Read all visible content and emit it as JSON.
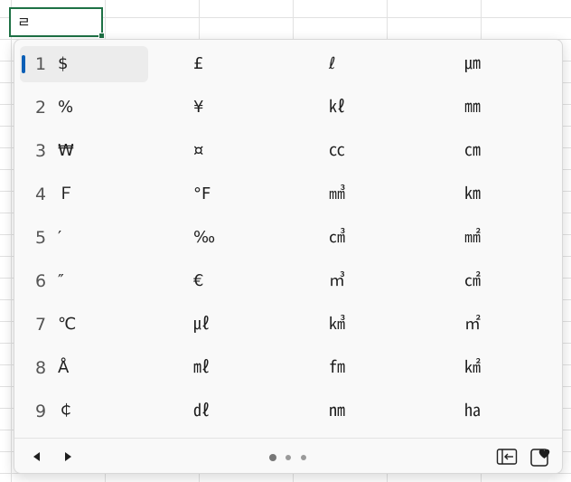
{
  "cell": {
    "value": "ㄹ"
  },
  "candidates": {
    "columns": [
      [
        {
          "num": "1",
          "sym": "$",
          "selected": true
        },
        {
          "num": "2",
          "sym": "%"
        },
        {
          "num": "3",
          "sym": "₩"
        },
        {
          "num": "4",
          "sym": "Ｆ"
        },
        {
          "num": "5",
          "sym": "′"
        },
        {
          "num": "6",
          "sym": "″"
        },
        {
          "num": "7",
          "sym": "℃"
        },
        {
          "num": "8",
          "sym": "Å"
        },
        {
          "num": "9",
          "sym": "￠"
        }
      ],
      [
        {
          "sym": "£"
        },
        {
          "sym": "¥"
        },
        {
          "sym": "¤"
        },
        {
          "sym": "°F"
        },
        {
          "sym": "‰"
        },
        {
          "sym": "€"
        },
        {
          "sym": "㎕"
        },
        {
          "sym": "㎖"
        },
        {
          "sym": "㎗"
        }
      ],
      [
        {
          "sym": "ℓ"
        },
        {
          "sym": "㎘"
        },
        {
          "sym": "㏄"
        },
        {
          "sym": "㎣"
        },
        {
          "sym": "㎤"
        },
        {
          "sym": "㎥"
        },
        {
          "sym": "㎦"
        },
        {
          "sym": "㎙"
        },
        {
          "sym": "㎚"
        }
      ],
      [
        {
          "sym": "㎛"
        },
        {
          "sym": "㎜"
        },
        {
          "sym": "㎝"
        },
        {
          "sym": "㎞"
        },
        {
          "sym": "㎟"
        },
        {
          "sym": "㎠"
        },
        {
          "sym": "㎡"
        },
        {
          "sym": "㎢"
        },
        {
          "sym": "㏊"
        }
      ]
    ]
  },
  "footer": {
    "prev_icon": "triangle-left-icon",
    "next_icon": "triangle-right-icon",
    "page_dots": 3,
    "active_dot": 0,
    "expand_icon": "panel-collapse-icon",
    "favorites_icon": "heart-icon"
  },
  "colors": {
    "accent": "#0a5fb6",
    "cell_border": "#1e7145"
  }
}
